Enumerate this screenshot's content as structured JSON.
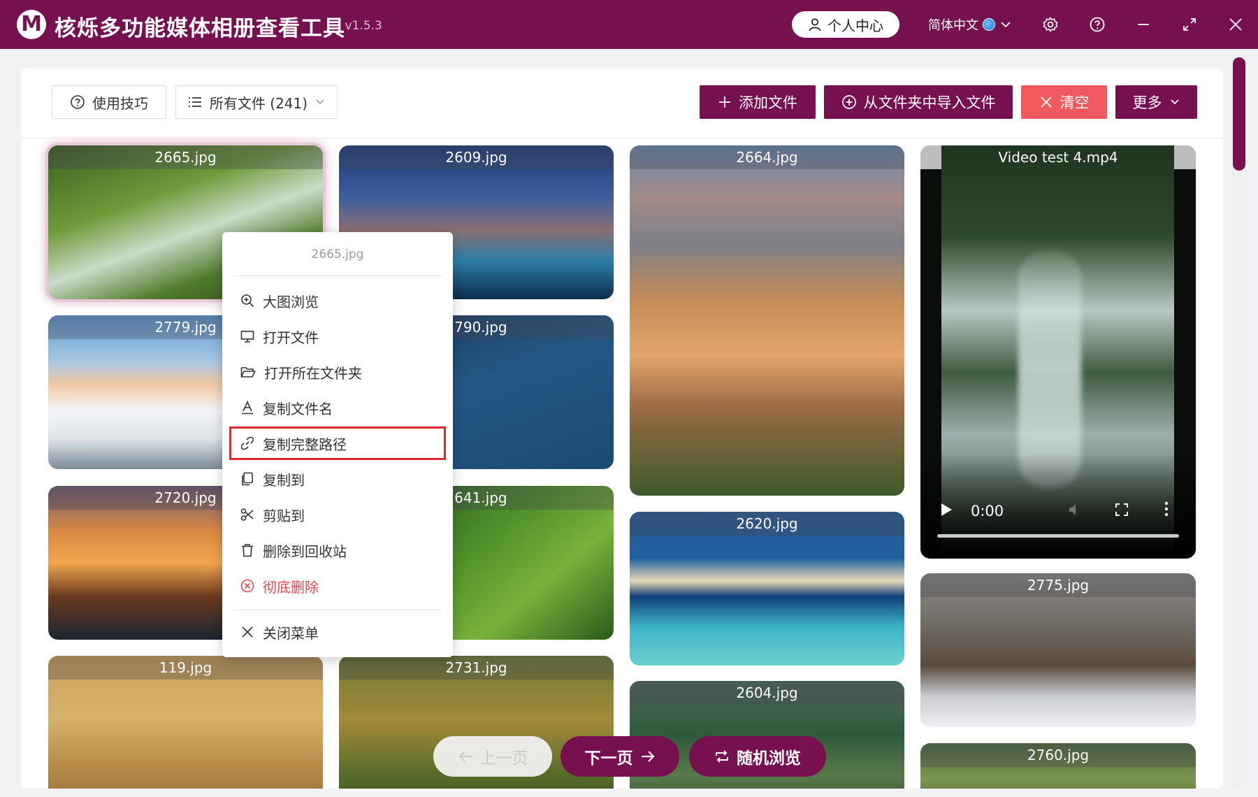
{
  "app": {
    "logo_letter": "M",
    "title": "核烁多功能媒体相册查看工具",
    "version": "- v1.5.3"
  },
  "titlebar": {
    "user_center": "个人中心",
    "language": "简体中文",
    "icons": [
      "settings-icon",
      "help-icon",
      "minimize-icon",
      "maximize-icon",
      "close-icon"
    ]
  },
  "toolbar": {
    "tips": "使用技巧",
    "all_files": "所有文件 (241)",
    "add_files": "添加文件",
    "import_folder": "从文件夹中导入文件",
    "clear": "清空",
    "more": "更多"
  },
  "grid": {
    "col1": [
      "2665.jpg",
      "2779.jpg",
      "2720.jpg",
      "119.jpg"
    ],
    "col2": [
      "2609.jpg",
      "2790.jpg",
      "2641.jpg",
      "2731.jpg"
    ],
    "col3": [
      "2664.jpg",
      "2620.jpg",
      "2604.jpg"
    ],
    "col4": [
      "Video test 4.mp4",
      "2775.jpg",
      "2760.jpg"
    ]
  },
  "video": {
    "time": "0:00"
  },
  "context_menu": {
    "title": "2665.jpg",
    "items": [
      "大图浏览",
      "打开文件",
      "打开所在文件夹",
      "复制文件名",
      "复制完整路径",
      "复制到",
      "剪贴到",
      "删除到回收站",
      "彻底删除",
      "关闭菜单"
    ]
  },
  "pager": {
    "prev": "上一页",
    "next": "下一页",
    "random": "随机浏览"
  },
  "colors": {
    "brand": "#77104f",
    "danger": "#f05a5e",
    "highlight": "#e02b2b"
  }
}
